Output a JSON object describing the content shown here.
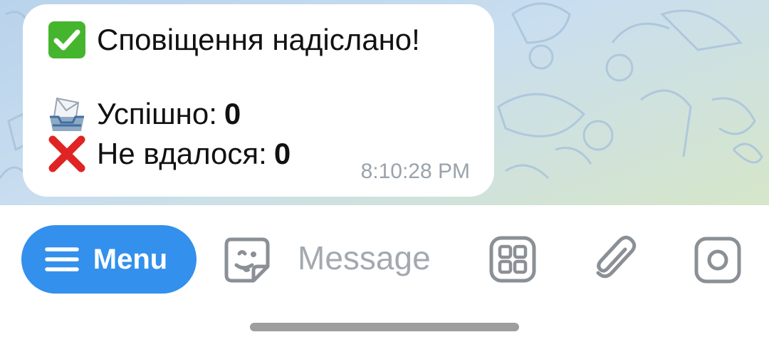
{
  "message": {
    "title_icon": "check-mark-icon",
    "title": "Сповіщення надіслано!",
    "success_icon": "inbox-tray-icon",
    "success_label": "Успішно:",
    "success_count": "0",
    "failed_icon": "cross-mark-icon",
    "failed_label": "Не вдалося:",
    "failed_count": "0",
    "time": "8:10:28 PM"
  },
  "input_bar": {
    "menu_label": "Menu",
    "message_placeholder": "Message",
    "icons": [
      "menu-lines-icon",
      "sticker-icon",
      "bot-commands-icon",
      "attach-icon",
      "camera-icon"
    ]
  },
  "colors": {
    "accent": "#3390ec",
    "check_green": "#45b52d",
    "cross_red": "#e02424",
    "icon_gray": "#8a9096",
    "timestamp_gray": "#9aa3ab"
  }
}
